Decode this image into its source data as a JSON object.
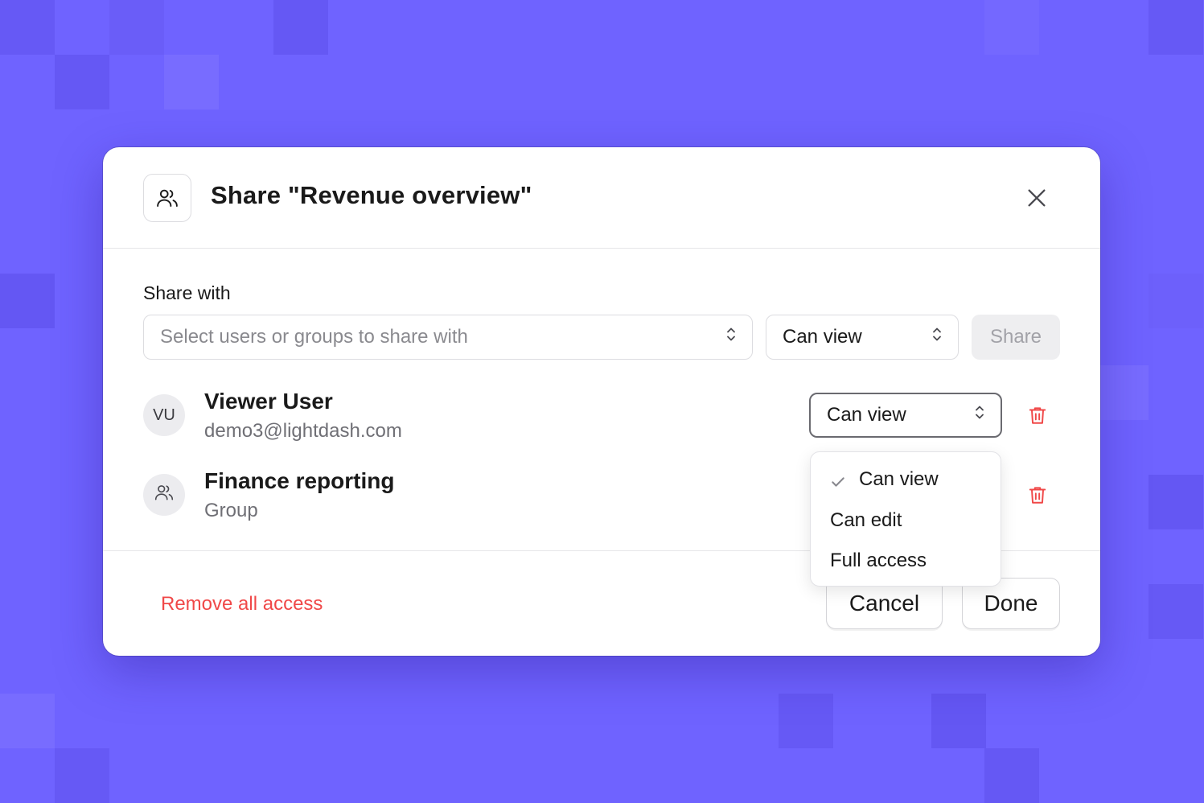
{
  "colors": {
    "background": "#6f63ff",
    "accent_danger": "#f04848",
    "text_primary": "#1a1a1a",
    "text_muted": "#6f6f75"
  },
  "dialog": {
    "icon": "users-icon",
    "title": "Share \"Revenue overview\"",
    "close_icon": "close-icon"
  },
  "share_with": {
    "label": "Share with",
    "user_select_placeholder": "Select users or groups to share with",
    "permission_value": "Can view",
    "share_button": "Share"
  },
  "access_list": [
    {
      "avatar": "VU",
      "name": "Viewer User",
      "subtitle": "demo3@lightdash.com",
      "permission": "Can view",
      "delete_icon": "trash-icon"
    },
    {
      "avatar_icon": "users-icon",
      "name": "Finance reporting",
      "subtitle": "Group",
      "delete_icon": "trash-icon"
    }
  ],
  "permission_dropdown": {
    "options": [
      "Can view",
      "Can edit",
      "Full access"
    ],
    "selected": "Can view"
  },
  "footer": {
    "remove_all": "Remove all access",
    "cancel": "Cancel",
    "done": "Done"
  }
}
